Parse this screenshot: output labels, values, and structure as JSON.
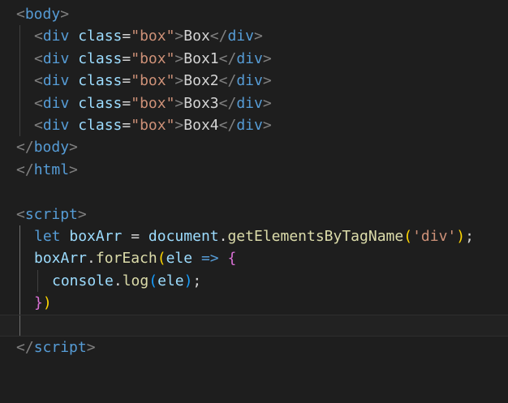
{
  "editor": {
    "language": "html",
    "colors": {
      "background": "#1e1e1e",
      "tag": "#569cd6",
      "attribute": "#9cdcfe",
      "string": "#ce9178",
      "function": "#dcdcaa",
      "bracket_level1": "#ffd700",
      "bracket_level2": "#da70d6",
      "bracket_level3": "#179fff"
    },
    "lines": [
      {
        "open": "<",
        "tag": "body",
        "close": ">"
      },
      {
        "open": "<",
        "tag": "div",
        "attr": "class",
        "eq": "=",
        "val": "\"box\"",
        "gt": ">",
        "text": "Box",
        "close_open": "</",
        "close_tag": "div",
        "close_gt": ">"
      },
      {
        "open": "<",
        "tag": "div",
        "attr": "class",
        "eq": "=",
        "val": "\"box\"",
        "gt": ">",
        "text": "Box1",
        "close_open": "</",
        "close_tag": "div",
        "close_gt": ">"
      },
      {
        "open": "<",
        "tag": "div",
        "attr": "class",
        "eq": "=",
        "val": "\"box\"",
        "gt": ">",
        "text": "Box2",
        "close_open": "</",
        "close_tag": "div",
        "close_gt": ">"
      },
      {
        "open": "<",
        "tag": "div",
        "attr": "class",
        "eq": "=",
        "val": "\"box\"",
        "gt": ">",
        "text": "Box3",
        "close_open": "</",
        "close_tag": "div",
        "close_gt": ">"
      },
      {
        "open": "<",
        "tag": "div",
        "attr": "class",
        "eq": "=",
        "val": "\"box\"",
        "gt": ">",
        "text": "Box4",
        "close_open": "</",
        "close_tag": "div",
        "close_gt": ">"
      },
      {
        "open": "</",
        "tag": "body",
        "close": ">"
      },
      {
        "open": "</",
        "tag": "html",
        "close": ">"
      },
      {
        "empty": ""
      },
      {
        "open": "<",
        "tag": "script",
        "close": ">"
      },
      {
        "kw": "let",
        "var": "boxArr",
        "op": "=",
        "obj": "document",
        "dot": ".",
        "fn": "getElementsByTagName",
        "lp": "(",
        "arg": "'div'",
        "rp": ")",
        "semi": ";"
      },
      {
        "var": "boxArr",
        "dot": ".",
        "fn": "forEach",
        "lp": "(",
        "param": "ele",
        "arrow": "=>",
        "lb": "{"
      },
      {
        "obj": "console",
        "dot": ".",
        "fn": "log",
        "lp": "(",
        "arg": "ele",
        "rp": ")",
        "semi": ";"
      },
      {
        "rb": "}",
        "rp": ")"
      },
      {
        "empty": ""
      },
      {
        "open": "</",
        "tag": "script",
        "close": ">"
      }
    ]
  }
}
